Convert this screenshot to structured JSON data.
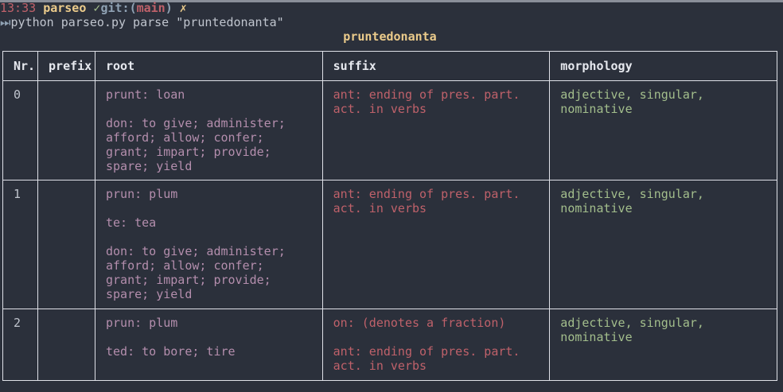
{
  "prompt": {
    "time": "13:33",
    "dir": "parseo",
    "check": "✓",
    "git_label": "git:",
    "branch_open": "(",
    "branch": "main",
    "branch_close": ")",
    "dirty_mark": "✗"
  },
  "command": {
    "icon": "⏭",
    "text": "python parseo.py parse \"pruntedonanta\""
  },
  "table": {
    "title": "pruntedonanta",
    "headers": {
      "nr": "Nr.",
      "prefix": "prefix",
      "root": "root",
      "suffix": "suffix",
      "morphology": "morphology"
    },
    "rows": [
      {
        "nr": "0",
        "prefix": "",
        "root": [
          "prunt: loan",
          "don: to give; administer;\nafford; allow; confer;\ngrant; impart; provide;\nspare; yield"
        ],
        "suffix": [
          "ant: ending of pres. part.\nact. in verbs"
        ],
        "morphology": "adjective, singular,\nnominative"
      },
      {
        "nr": "1",
        "prefix": "",
        "root": [
          "prun: plum",
          "te: tea",
          "don: to give; administer;\nafford; allow; confer;\ngrant; impart; provide;\nspare; yield"
        ],
        "suffix": [
          "ant: ending of pres. part.\nact. in verbs"
        ],
        "morphology": "adjective, singular,\nnominative"
      },
      {
        "nr": "2",
        "prefix": "",
        "root": [
          "prun: plum",
          "ted: to bore; tire"
        ],
        "suffix": [
          "on: (denotes a fraction)",
          "ant: ending of pres. part.\nact. in verbs"
        ],
        "morphology": "adjective, singular,\nnominative"
      }
    ]
  },
  "colors": {
    "background": "#2b303b",
    "time": "#bf616a",
    "dir": "#ebcb8b",
    "check": "#a3be8c",
    "git": "#8fa1b3",
    "root": "#b48ead",
    "suffix": "#bf616a",
    "morphology": "#a3be8c",
    "title": "#ebcb8b",
    "border": "#dfe1e8"
  }
}
